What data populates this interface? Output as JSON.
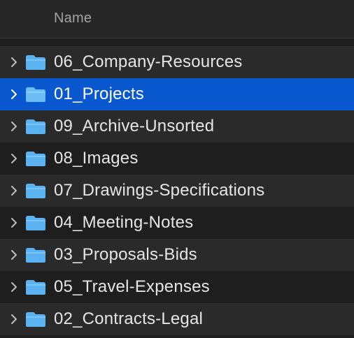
{
  "header": {
    "column_name": "Name"
  },
  "colors": {
    "background": "#1e1e1e",
    "header_background": "#262626",
    "alt_row": "#2a2a2a",
    "selection": "#0a58d0",
    "folder": "#5ab3f0"
  },
  "rows": [
    {
      "label": "06_Company-Resources",
      "icon": "folder-icon",
      "expanded": false,
      "selected": false
    },
    {
      "label": "01_Projects",
      "icon": "folder-icon",
      "expanded": false,
      "selected": true
    },
    {
      "label": "09_Archive-Unsorted",
      "icon": "folder-icon",
      "expanded": false,
      "selected": false
    },
    {
      "label": "08_Images",
      "icon": "folder-icon",
      "expanded": false,
      "selected": false
    },
    {
      "label": "07_Drawings-Specifications",
      "icon": "folder-icon",
      "expanded": false,
      "selected": false
    },
    {
      "label": "04_Meeting-Notes",
      "icon": "folder-icon",
      "expanded": false,
      "selected": false
    },
    {
      "label": "03_Proposals-Bids",
      "icon": "folder-icon",
      "expanded": false,
      "selected": false
    },
    {
      "label": "05_Travel-Expenses",
      "icon": "folder-icon",
      "expanded": false,
      "selected": false
    },
    {
      "label": "02_Contracts-Legal",
      "icon": "folder-icon",
      "expanded": false,
      "selected": false
    }
  ]
}
